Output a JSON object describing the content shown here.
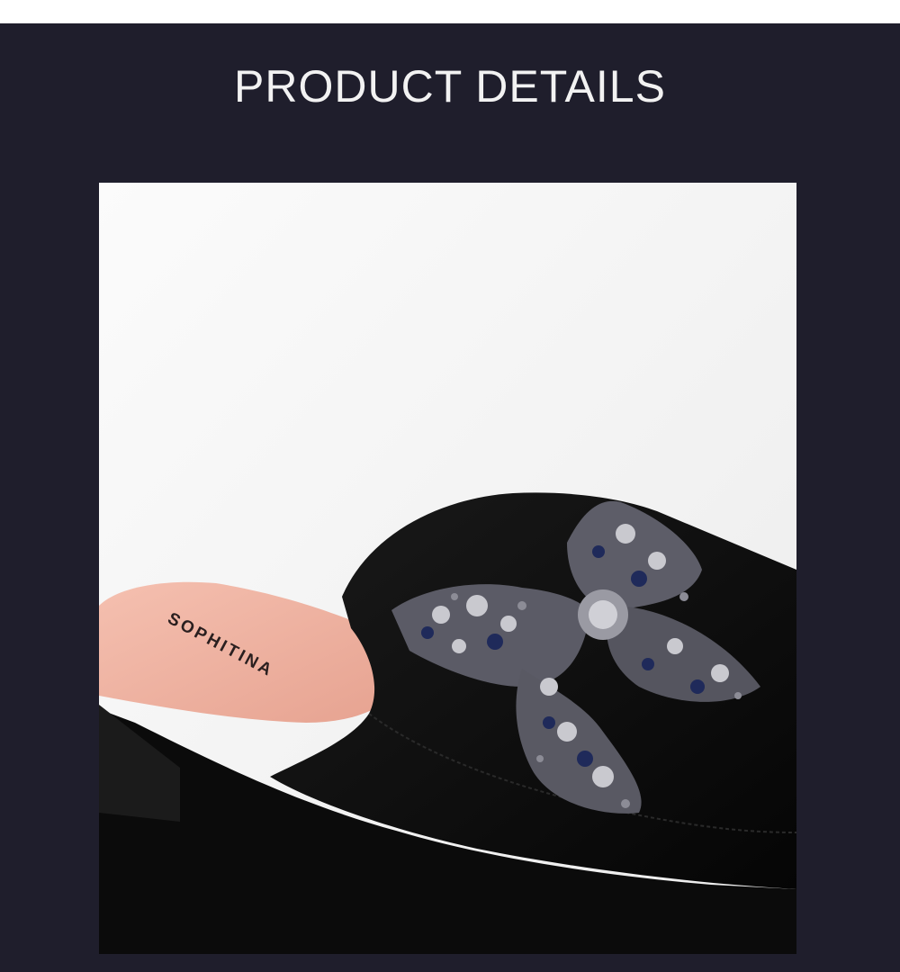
{
  "header": {
    "title": "PRODUCT DETAILS"
  },
  "product_photo": {
    "insole_brand": "SOPHITINA",
    "subject": "black suede flat mule with rhinestone bow"
  },
  "colors": {
    "panel_background": "#1f1e2c",
    "title_text": "#f2f2f2",
    "photo_background": "#f3f3f3",
    "suede": "#0d0d0d",
    "insole": "#f0b3a3",
    "gem_dark": "#1f2a5a",
    "gem_light": "#c9c9cf"
  }
}
